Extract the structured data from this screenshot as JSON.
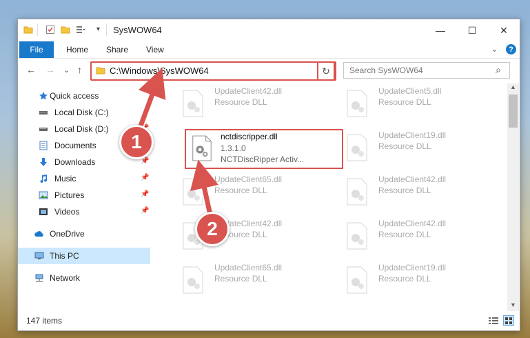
{
  "window": {
    "title": "SysWOW64",
    "controls": {
      "minimize": "—",
      "maximize": "☐",
      "close": "✕"
    }
  },
  "ribbon": {
    "tabs": [
      "File",
      "Home",
      "Share",
      "View"
    ],
    "help_icon": "?",
    "collapse_icon": "⌄"
  },
  "nav": {
    "back": "←",
    "forward": "→",
    "recent": "⌄",
    "up": "↑",
    "address": "C:\\Windows\\SysWOW64",
    "dropdown": "⌄",
    "refresh": "↻",
    "search_placeholder": "Search SysWOW64",
    "search_icon": "⌕"
  },
  "sidebar": {
    "items": [
      {
        "label": "Quick access",
        "icon": "star-icon",
        "pinned": false
      },
      {
        "label": "Local Disk (C:)",
        "icon": "drive-icon",
        "pinned": false
      },
      {
        "label": "Local Disk (D:)",
        "icon": "drive-icon",
        "pinned": true
      },
      {
        "label": "Documents",
        "icon": "documents-icon",
        "pinned": true
      },
      {
        "label": "Downloads",
        "icon": "download-icon",
        "pinned": true
      },
      {
        "label": "Music",
        "icon": "music-icon",
        "pinned": true
      },
      {
        "label": "Pictures",
        "icon": "pictures-icon",
        "pinned": true
      },
      {
        "label": "Videos",
        "icon": "videos-icon",
        "pinned": true
      },
      {
        "label": "OneDrive",
        "icon": "cloud-icon",
        "pinned": false
      },
      {
        "label": "This PC",
        "icon": "computer-icon",
        "pinned": false,
        "selected": true
      },
      {
        "label": "Network",
        "icon": "network-icon",
        "pinned": false
      }
    ],
    "pin_glyph": "📌"
  },
  "files": [
    {
      "name": "UpdateClient42.dll",
      "type": "Resource DLL"
    },
    {
      "name": "UpdateClient5.dll",
      "type": "Resource DLL"
    },
    {
      "name": "UpdateClient19.dll",
      "type": "Resource DLL"
    },
    {
      "name": "UpdateClient65.dll",
      "type": "Resource DLL"
    },
    {
      "name": "UpdateClient42.dll",
      "type": "Resource DLL"
    },
    {
      "name": "UpdateClient42.dll",
      "type": "Resource DLL"
    },
    {
      "name": "UpdateClient42.dll",
      "type": "Resource DLL"
    },
    {
      "name": "UpdateClient65.dll",
      "type": "Resource DLL"
    },
    {
      "name": "UpdateClient19.dll",
      "type": "Resource DLL"
    }
  ],
  "highlighted_file": {
    "name": "nctdiscripper.dll",
    "version": "1.3.1.0",
    "description": "NCTDiscRipper Activ..."
  },
  "status": {
    "count": "147 items"
  },
  "callouts": {
    "one": "1",
    "two": "2"
  },
  "colors": {
    "accent": "#1979ca",
    "highlight": "#d9534f",
    "selected": "#cce8ff"
  }
}
